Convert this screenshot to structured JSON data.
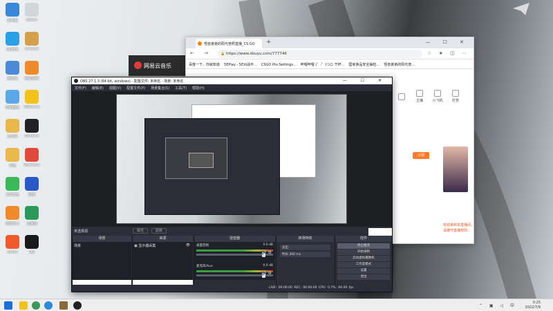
{
  "desktop_icons": [
    {
      "label": "此电脑",
      "color": "#3a87d8"
    },
    {
      "label": "Steam",
      "color": "#d0d6da"
    },
    {
      "label": "QQ音乐",
      "color": "#2aa0e8"
    },
    {
      "label": "Chrome",
      "color": "#d6a04a"
    },
    {
      "label": "回收站",
      "color": "#4a8ad8"
    },
    {
      "label": "腾讯视频",
      "color": "#f08a2a"
    },
    {
      "label": "控制面板",
      "color": "#5aa8e8"
    },
    {
      "label": "WeGame",
      "color": "#f2c21a"
    },
    {
      "label": "文件夹",
      "color": "#e8b84a"
    },
    {
      "label": "GeForce",
      "color": "#222222"
    },
    {
      "label": "文档",
      "color": "#e8b84a"
    },
    {
      "label": "Microsoft",
      "color": "#e04a3a"
    },
    {
      "label": "360安全",
      "color": "#3ab85a"
    },
    {
      "label": "网络",
      "color": "#2a5ac8"
    },
    {
      "label": "游戏中心",
      "color": "#f08a2a"
    },
    {
      "label": "加速器",
      "color": "#2a9a5a"
    },
    {
      "label": "Office",
      "color": "#f05a2a"
    },
    {
      "label": "QQ",
      "color": "#1a1a1a"
    }
  ],
  "browser": {
    "tab_title": "怪兽弟弟的阳光普照直播_CS:GO",
    "new_tab": "+",
    "window_controls": "— ☐ ✕",
    "nav": "← → ↻ ⌂",
    "url": "https://www.douyu.com/777746",
    "toolbar_icons": "☆ ★ ◫ ⋯",
    "bookmarks": [
      "百度一下，你就知道",
      "5EPlay - 5E对战平...",
      "CSGO Pro Settings...",
      "哔哩哔哩 (゜-゜)つロ 干杯...",
      "国家食品安全抽检...",
      "怪兽弟弟的阳光普..."
    ],
    "side_labels": [
      "",
      "主播",
      "小飞机",
      "打赏"
    ],
    "orange_button": "订阅",
    "orange_text": "欢迎来到本直播间，请遵守直播规则..."
  },
  "netease": {
    "label": "网易云音乐"
  },
  "obs": {
    "title": "OBS 27.1.3 (64-bit, windows) - 配置文件: 未命名 - 场景: 未命名",
    "window_controls": "— ☐ ✕",
    "menu": [
      "文件(F)",
      "编辑(E)",
      "视图(V)",
      "配置文件(P)",
      "场景集合(S)",
      "工具(T)",
      "帮助(H)"
    ],
    "source_label": "未选择源",
    "scene_buttons": [
      "属性",
      "滤镜"
    ],
    "docks": {
      "scenes": {
        "title": "场景",
        "items": [
          "场景"
        ]
      },
      "sources": {
        "title": "来源",
        "items": [
          "显示器采集"
        ]
      },
      "mixer": {
        "title": "混音器",
        "tracks": [
          {
            "name": "桌面音频",
            "level": "0.0 dB"
          },
          {
            "name": "麦克风/Aux",
            "level": "0.0 dB"
          }
        ]
      },
      "transitions": {
        "title": "转场特效",
        "type": "淡出",
        "duration_label": "时长",
        "duration": "300 ms"
      },
      "controls": {
        "title": "控件",
        "buttons": [
          "停止推流",
          "开始录制",
          "启动虚拟摄像机",
          "工作室模式",
          "设置",
          "退出"
        ]
      }
    },
    "status": "LIVE: 00:00:00   REC: 00:00:00   CPU: 0.7%, 60.00 fps"
  },
  "taskbar": {
    "time": "0:25",
    "date": "2022/7/9",
    "tray": "⌃ ▣ ◁ 中"
  }
}
